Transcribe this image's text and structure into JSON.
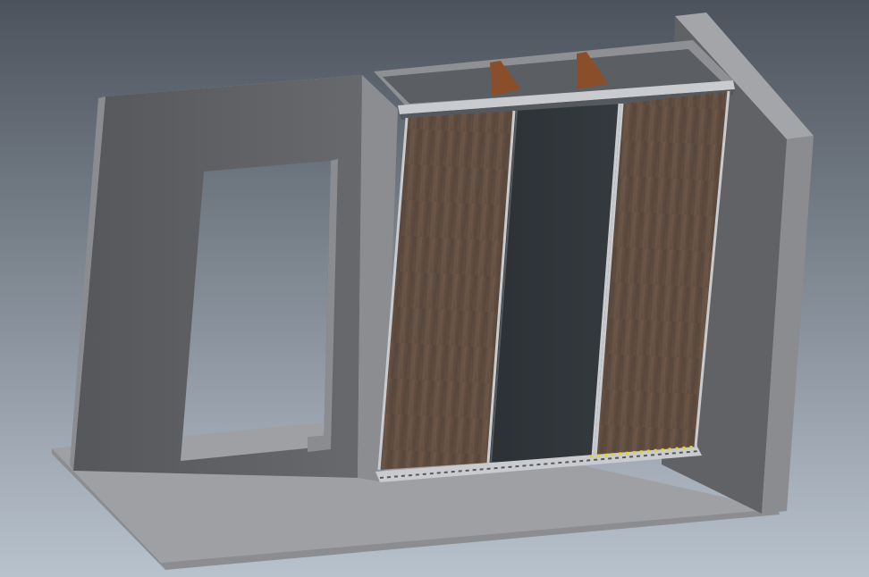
{
  "viewport": {
    "background_top": "#4c535c",
    "background_bottom": "#b8c2cd"
  },
  "model": {
    "colors": {
      "floor": "#9ea0a3",
      "floor_edge": "#8b8d90",
      "wall_face": "#606266",
      "wall_edge": "#8a8c90",
      "wall_top": "#a3a5a8",
      "cabinet_top": "#8e9094",
      "cabinet_frame": "#8b8d91",
      "interior_back": "#5b5e62",
      "shelf_divider": "#8a4f2a",
      "walnut_panel": "#5c4a3d",
      "dark_panel": "#30353a",
      "rail_light": "#c9cbce",
      "rail_dark": "#55595e",
      "track_marker": "#e1d23a"
    },
    "door_panels": [
      {
        "name": "left-walnut-door",
        "finish": "walnut"
      },
      {
        "name": "center-dark-door",
        "finish": "dark-gray"
      },
      {
        "name": "right-walnut-door",
        "finish": "walnut"
      }
    ],
    "shelf_dividers": 2,
    "opening": "doorway"
  }
}
